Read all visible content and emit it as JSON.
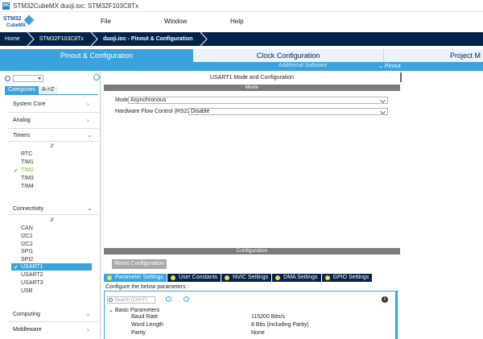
{
  "window": {
    "title": "STM32CubeMX duoji.ioc: STM32F103C8Tx",
    "app_icon_text": "MX"
  },
  "logo": {
    "line1": "STM32",
    "line2": "CubeMX"
  },
  "menu": {
    "file": "File",
    "window": "Window",
    "help": "Help"
  },
  "breadcrumbs": [
    "Home",
    "STM32F103C8Tx",
    "duoji.ioc - Pinout & Configuration"
  ],
  "tabs": {
    "pinout": "Pinout & Configuration",
    "clock": "Clock Configuration",
    "project": "Project M"
  },
  "subtabs": {
    "additional": "Additional Software",
    "pinout": "Pinout"
  },
  "left": {
    "categories_tab": "Categories",
    "az_tab": "A->Z",
    "system_core": "System Core",
    "analog": "Analog",
    "timers": "Timers",
    "timers_items": [
      "RTC",
      "TIM1",
      "TIM2",
      "TIM3",
      "TIM4"
    ],
    "connectivity": "Connectivity",
    "conn_items": [
      "CAN",
      "I2C1",
      "I2C2",
      "SPI1",
      "SPI2",
      "USART1",
      "USART2",
      "USART3",
      "USB"
    ],
    "computing": "Computing",
    "middleware": "Middleware"
  },
  "main": {
    "header": "USART1 Mode and Configuration",
    "mode_section": "Mode",
    "mode_label": "Mode",
    "mode_value": "Asynchronous",
    "flow_label": "Hardware Flow Control (RS232)",
    "flow_value": "Disable",
    "config_section": "Configuration",
    "reset_button": "Reset Configuration",
    "config_tabs": [
      "Parameter Settings",
      "User Constants",
      "NVIC Settings",
      "DMA Settings",
      "GPIO Settings"
    ],
    "configure_text": "Configure the below parameters :",
    "search_placeholder": "Search (Ctrl+F)",
    "basic_params": "Basic Parameters",
    "params": [
      {
        "name": "Baud Rate",
        "value": "115200 Bits/s"
      },
      {
        "name": "Word Length",
        "value": "8 Bits (including Parity)"
      },
      {
        "name": "Parity",
        "value": "None"
      }
    ]
  },
  "colors": {
    "accent": "#3aa3dc",
    "navy": "#03234b",
    "enabled": "#7aba1e"
  }
}
